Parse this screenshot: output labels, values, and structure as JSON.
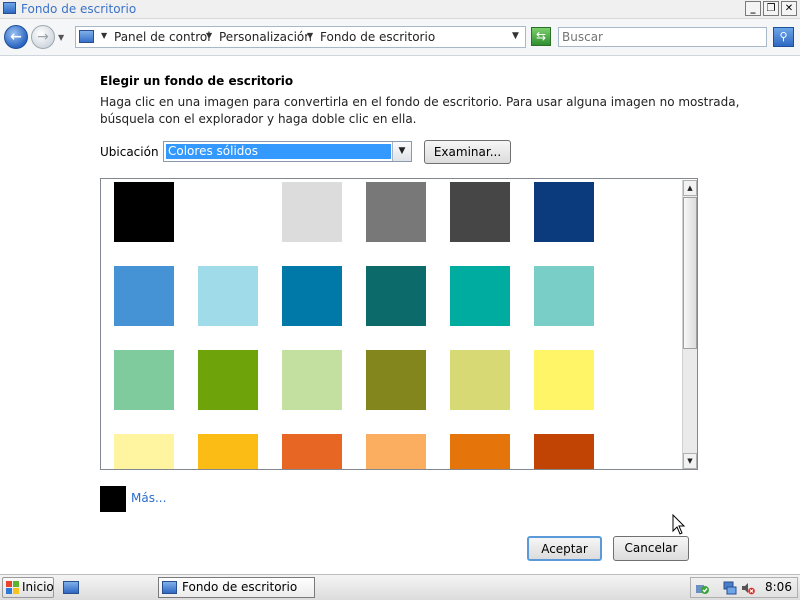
{
  "window": {
    "title": "Fondo de escritorio",
    "minimize_glyph": "_",
    "restore_glyph": "❐",
    "close_glyph": "✕"
  },
  "address": {
    "breadcrumbs": [
      "Panel de control",
      "Personalización",
      "Fondo de escritorio"
    ],
    "search_placeholder": "Buscar"
  },
  "content": {
    "heading": "Elegir un fondo de escritorio",
    "description_line1": "Haga clic en una imagen para convertirla en el fondo de escritorio. Para usar alguna imagen no mostrada,",
    "description_line2": "búsquela con el explorador y haga doble clic en ella.",
    "location_label": "Ubicación",
    "location_value": "Colores sólidos",
    "browse_label": "Examinar...",
    "more_label": "Más...",
    "current_color": "#000000",
    "swatches": [
      [
        "#000000",
        "#ffffff",
        "#dcdcdc",
        "#787878",
        "#464646",
        "#0b3b7c"
      ],
      [
        "#4593d4",
        "#9fdbe8",
        "#0079a8",
        "#0d6a6b",
        "#00aba0",
        "#79cfc8"
      ],
      [
        "#80cb9d",
        "#6ea409",
        "#c4e0a0",
        "#83861c",
        "#d7d975",
        "#fff567"
      ],
      [
        "#fff5a0",
        "#fbbc15",
        "#e86623",
        "#fbad60",
        "#e5740a",
        "#c24405"
      ]
    ]
  },
  "actions": {
    "accept_label": "Aceptar",
    "cancel_label": "Cancelar"
  },
  "taskbar": {
    "start_label": "Inicio",
    "task_label": "Fondo de escritorio",
    "clock": "8:06"
  },
  "colors": {
    "title_text": "#3a72c8",
    "selection": "#3399ff",
    "link": "#2a6ecb"
  }
}
